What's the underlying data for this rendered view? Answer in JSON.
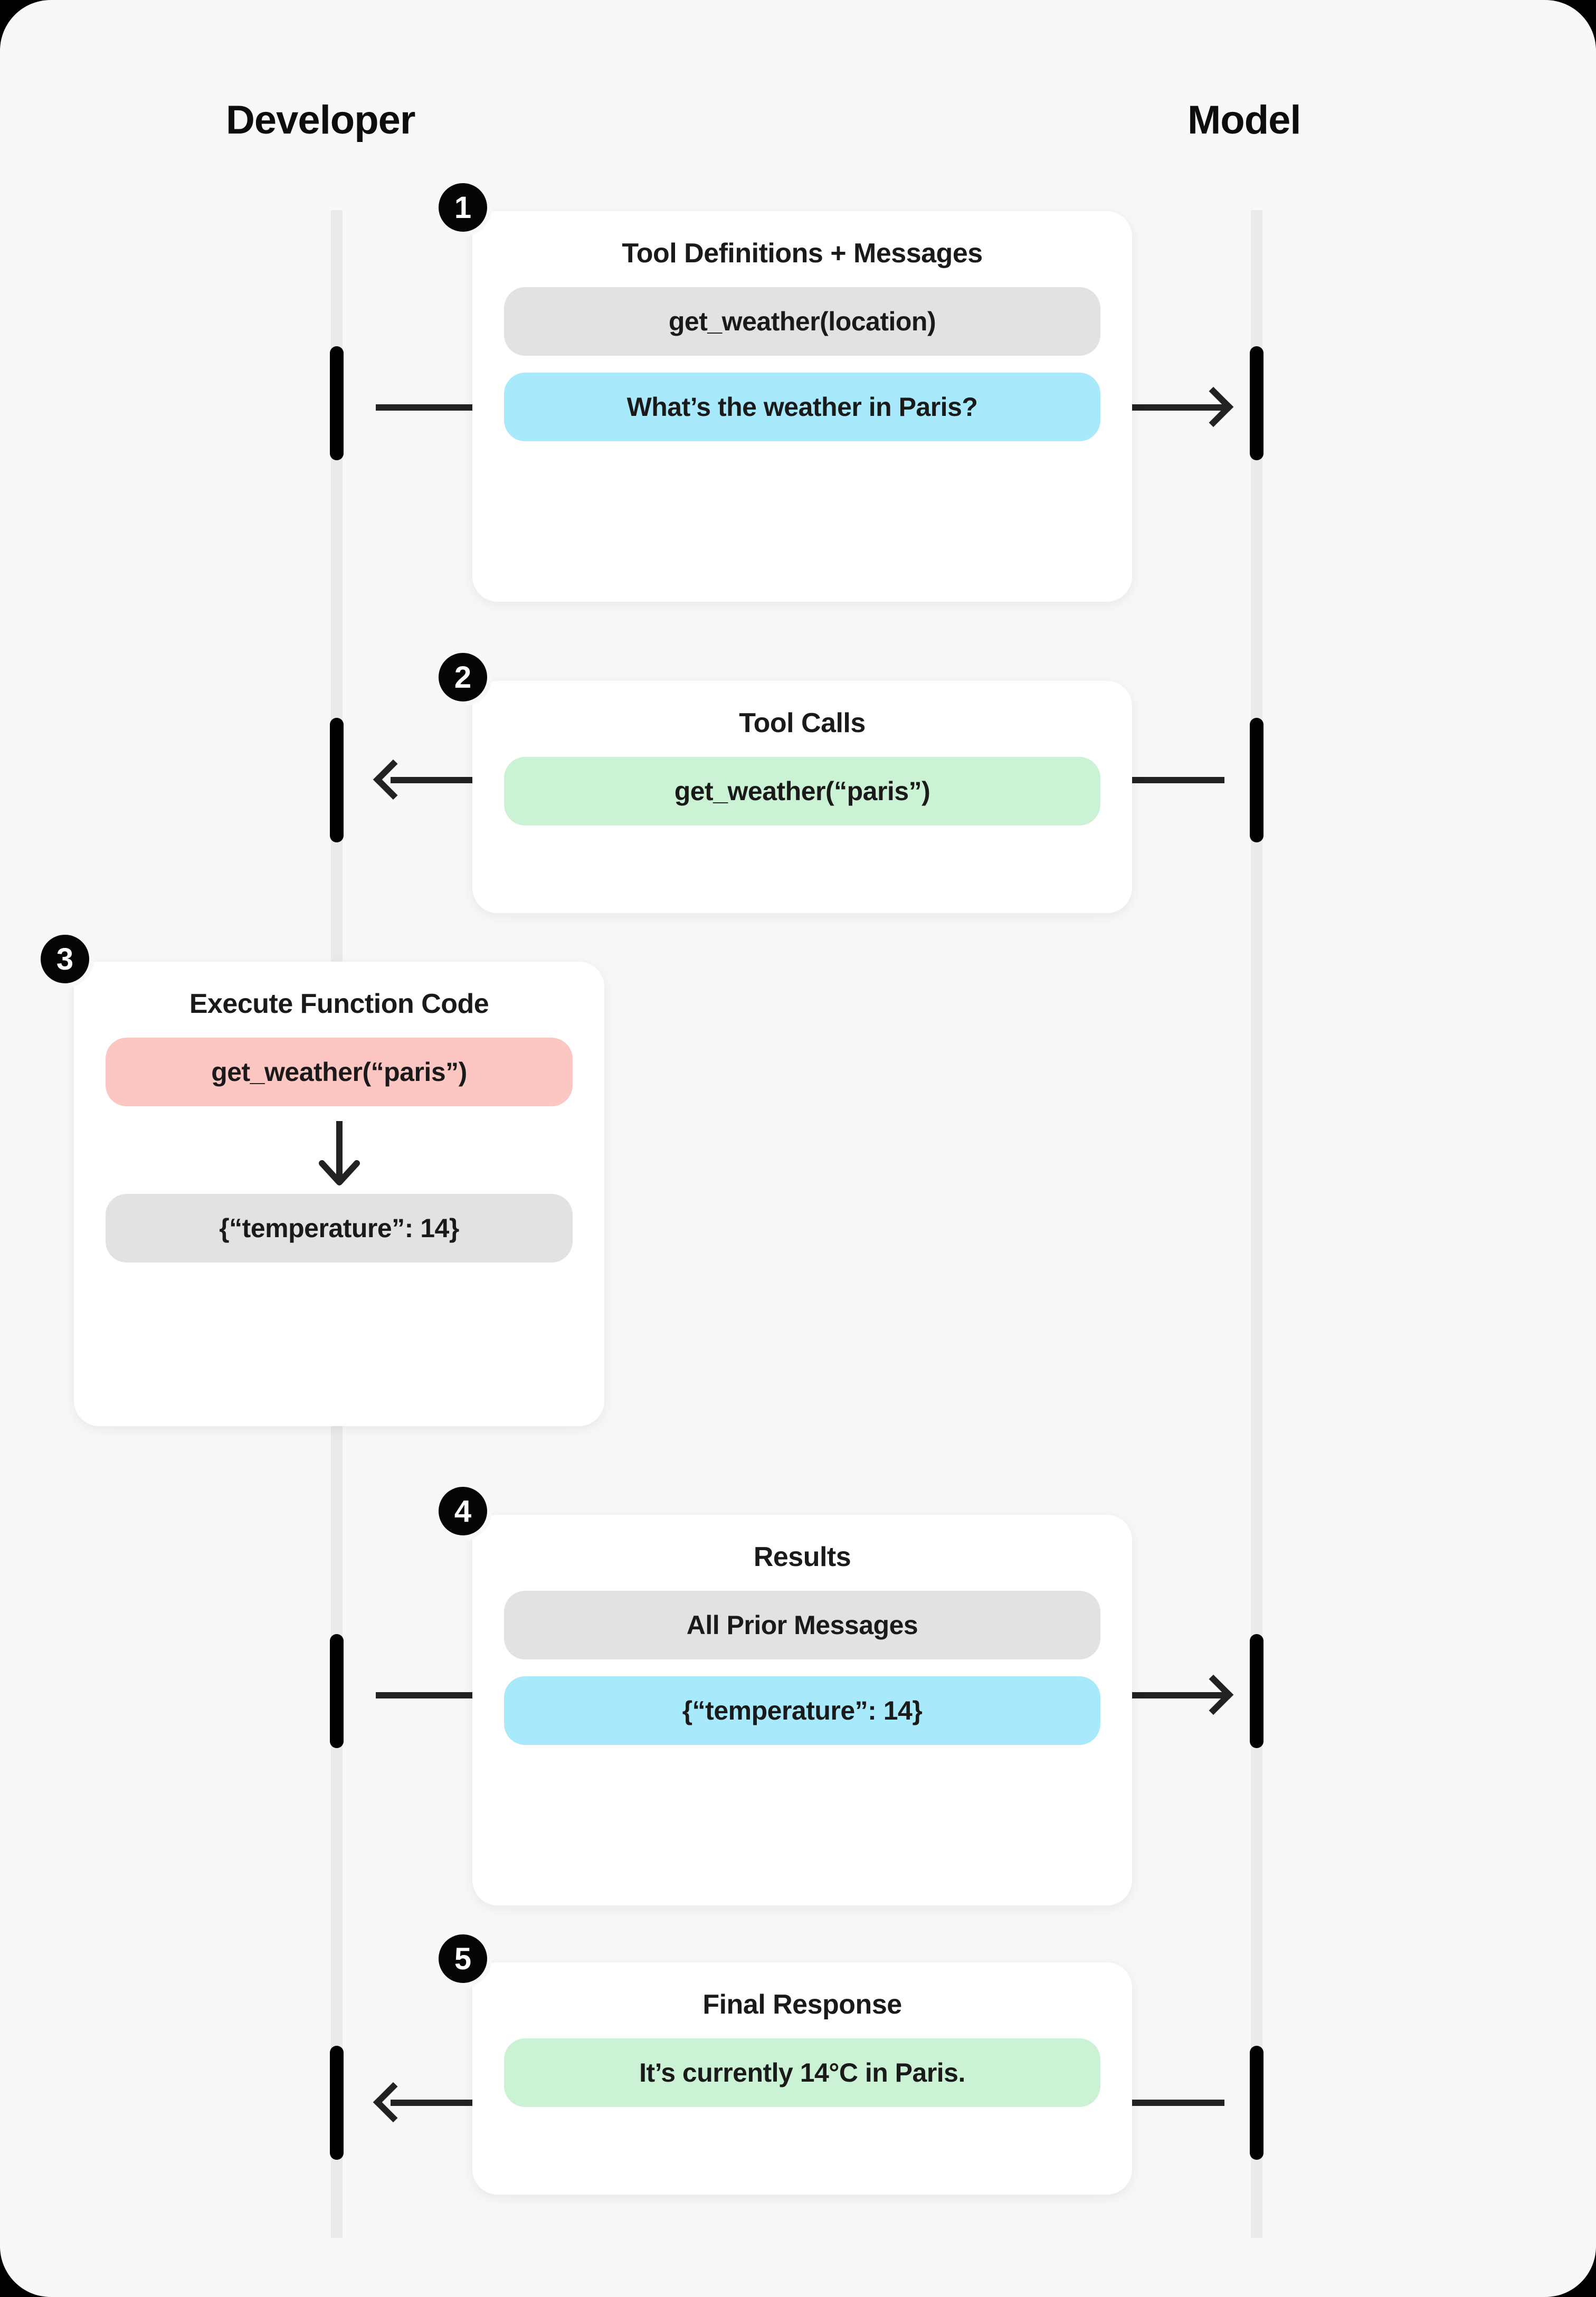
{
  "columns": {
    "left_label": "Developer",
    "right_label": "Model"
  },
  "colors": {
    "canvas_bg": "#F8F8F8",
    "card_bg": "#FFFFFF",
    "lifeline": "#EAEAEA",
    "activation": "#000000",
    "arrow": "#222222",
    "badge_bg": "#050505",
    "pill_gray": "#E2E2E2",
    "pill_blue": "#A9E9FC",
    "pill_green": "#CCF2D5",
    "pill_pink": "#FCC6C3"
  },
  "steps": [
    {
      "number": "1",
      "title": "Tool Definitions + Messages",
      "direction": "right",
      "pills": [
        {
          "text": "get_weather(location)",
          "color": "gray"
        },
        {
          "text": "What’s the weather in Paris?",
          "color": "blue"
        }
      ]
    },
    {
      "number": "2",
      "title": "Tool Calls",
      "direction": "left",
      "pills": [
        {
          "text": "get_weather(“paris”)",
          "color": "green"
        }
      ]
    },
    {
      "number": "3",
      "title": "Execute Function Code",
      "direction": "none",
      "pills": [
        {
          "text": "get_weather(“paris”)",
          "color": "pink"
        },
        {
          "text": "{“temperature”: 14}",
          "color": "gray"
        }
      ],
      "inner_arrow": "down-arrow-icon"
    },
    {
      "number": "4",
      "title": "Results",
      "direction": "right",
      "pills": [
        {
          "text": "All Prior Messages",
          "color": "gray"
        },
        {
          "text": "{“temperature”: 14}",
          "color": "blue"
        }
      ]
    },
    {
      "number": "5",
      "title": "Final Response",
      "direction": "left",
      "pills": [
        {
          "text": "It’s currently 14°C in Paris.",
          "color": "green"
        }
      ]
    }
  ]
}
